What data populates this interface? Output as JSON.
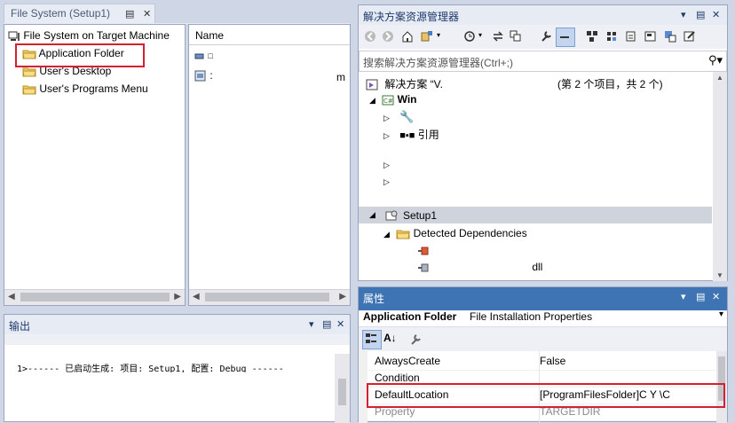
{
  "file_system": {
    "tab_title": "File System (Setup1)",
    "root": "File System on Target Machine",
    "items": [
      "Application Folder",
      "User's Desktop",
      "User's Programs Menu"
    ]
  },
  "name_pane": {
    "header": "Name",
    "rows": [
      "□",
      ":",
      "m"
    ]
  },
  "output": {
    "title": "输出",
    "line1": "1>------ 已启动生成: 项目: Setup1, 配置: Debug ------"
  },
  "solution_explorer": {
    "title": "解决方案资源管理器",
    "search_placeholder": "搜索解决方案资源管理器(Ctrl+;)",
    "solution_prefix": "解决方案 “V.",
    "solution_suffix": "(第 2 个项目，共 2 个)",
    "project_win": "Win",
    "references": "引用",
    "setup_project": "Setup1",
    "detected_deps": "Detected Dependencies",
    "dep_dll": "dll"
  },
  "properties": {
    "title": "属性",
    "object_name": "Application Folder",
    "object_type": "File Installation Properties",
    "rows": [
      {
        "key": "AlwaysCreate",
        "value": "False"
      },
      {
        "key": "Condition",
        "value": ""
      },
      {
        "key": "DefaultLocation",
        "value": "[ProgramFilesFolder]C      Y    \\C"
      },
      {
        "key": "Property",
        "value": "TARGETDIR"
      }
    ]
  },
  "colors": {
    "highlight_red": "#d42030",
    "active_header": "#3e74b4",
    "selected_row": "#cfd3dc"
  }
}
